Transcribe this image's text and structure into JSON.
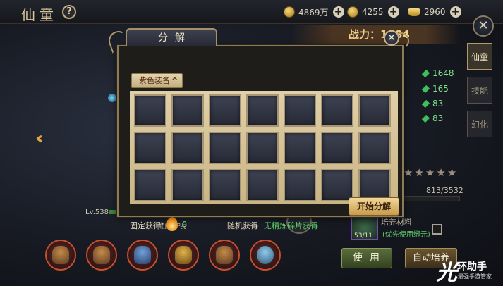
{
  "header": {
    "title": "仙童",
    "help_glyph": "?",
    "currencies": [
      {
        "icon": "gold-coin-icon",
        "value": "4869万"
      },
      {
        "icon": "coin-icon",
        "value": "4255"
      },
      {
        "icon": "ingot-icon",
        "value": "2960"
      }
    ],
    "plus_glyph": "+",
    "close_glyph": "✕"
  },
  "right_panel": {
    "power_label": "战力：1",
    "power_value": "584",
    "stats": [
      "1648",
      "165",
      "83",
      "83"
    ],
    "tabs": [
      {
        "label": "仙童",
        "active": true
      },
      {
        "label": "技能",
        "active": false
      },
      {
        "label": "幻化",
        "active": false
      }
    ],
    "stars_glyph": "★",
    "progress": "813/3532",
    "material_count": "53/11",
    "material_label": "培养材料",
    "material_hint": "(优先使用绑元)",
    "use_button": "使用",
    "auto_button": "自动培养"
  },
  "left_panel": {
    "arrow_glyph": "‹‹",
    "level": "Lv.538",
    "guard_label": "仙童护身"
  },
  "modal": {
    "title": "分解",
    "close_glyph": "✕",
    "filter_label": "紫色装备",
    "filter_chevron": "^",
    "slot_rows": 3,
    "slot_cols": 7,
    "fixed_label": "固定获得：",
    "fixed_value": "0",
    "random_label": "随机获得",
    "random_value": "无精炼碎片获得",
    "start_button": "开始分解"
  },
  "watermark": {
    "mark": "光",
    "name": "环助手",
    "sub": "最强手游管家"
  }
}
